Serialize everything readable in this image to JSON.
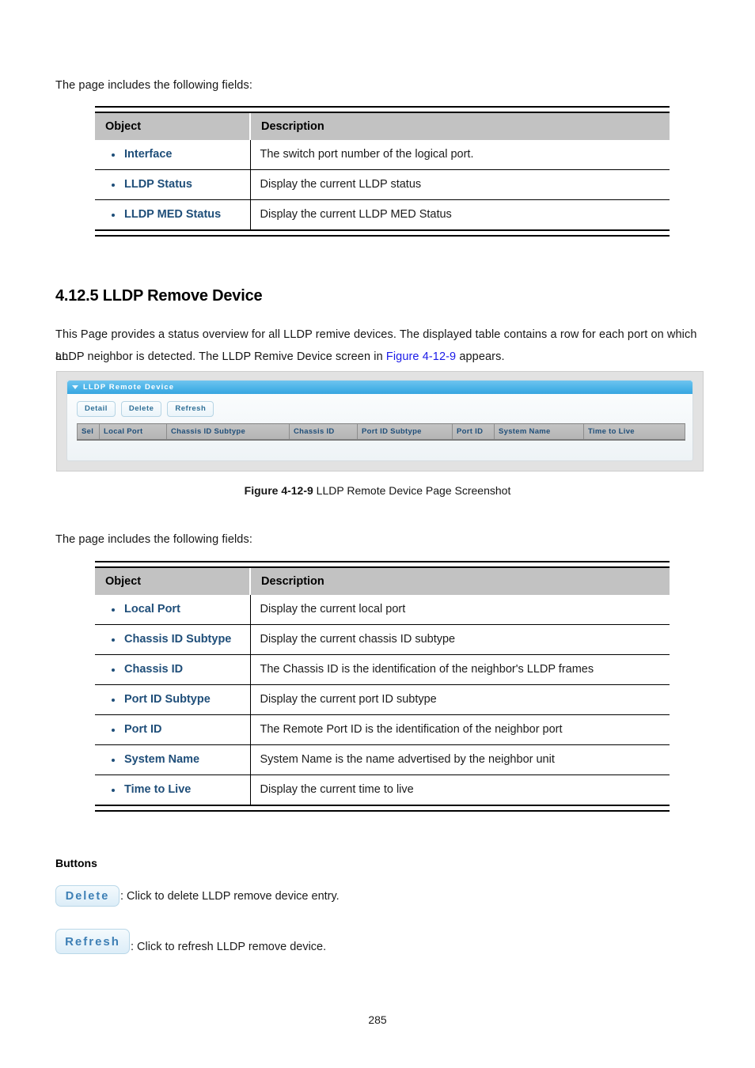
{
  "intro_text_1": "The page includes the following fields:",
  "table_1": {
    "headers": [
      "Object",
      "Description"
    ],
    "rows": [
      {
        "object": "Interface",
        "description": "The switch port number of the logical port."
      },
      {
        "object": "LLDP Status",
        "description": "Display the current LLDP status"
      },
      {
        "object": "LLDP MED Status",
        "description": "Display the current LLDP MED Status"
      }
    ]
  },
  "section": {
    "number": "4.12.5",
    "title": "4.12.5 LLDP Remove Device",
    "body_line_1_a": "This Page provides a status overview for all LLDP remive devices. The displayed table contains a row for each port on which an",
    "body_line_2_a": "LLDP neighbor is detected. The LLDP Remive Device screen in ",
    "body_line_2_link": "Figure 4-12-9",
    "body_line_2_b": " appears."
  },
  "screenshot": {
    "panel_title": "LLDP Remote Device",
    "caret_icon": "chevron-down-icon",
    "buttons": [
      "Detail",
      "Delete",
      "Refresh"
    ],
    "table_headers": [
      "Sel",
      "Local Port",
      "Chassis ID Subtype",
      "Chassis ID",
      "Port ID Subtype",
      "Port ID",
      "System Name",
      "Time to Live"
    ]
  },
  "figure_caption": {
    "label": "Figure 4-12-9",
    "text": " LLDP Remote Device Page Screenshot"
  },
  "intro_text_2": "The page includes the following fields:",
  "table_2": {
    "headers": [
      "Object",
      "Description"
    ],
    "rows": [
      {
        "object": "Local Port",
        "description": "Display the current local port"
      },
      {
        "object": "Chassis ID Subtype",
        "description": "Display the current chassis ID subtype"
      },
      {
        "object": "Chassis ID",
        "description": "The Chassis ID is the identification of the neighbor's LLDP frames"
      },
      {
        "object": "Port ID Subtype",
        "description": "Display the current port ID subtype"
      },
      {
        "object": "Port ID",
        "description": "The Remote Port ID is the identification of the neighbor port"
      },
      {
        "object": "System Name",
        "description": "System Name is the name advertised by the neighbor unit"
      },
      {
        "object": "Time to Live",
        "description": "Display the current time to live"
      }
    ]
  },
  "buttons_section": {
    "heading": "Buttons",
    "items": [
      {
        "button_label": "Delete",
        "description": ": Click to delete LLDP remove device entry."
      },
      {
        "button_label": "Refresh",
        "description": ": Click to refresh LLDP remove device."
      }
    ]
  },
  "page_number": "285",
  "colors": {
    "object_link": "#1f4e79",
    "xref_link": "#1a1ae8",
    "panel_header_blue": "#4cb4e8",
    "table_header_gray": "#bdbdbd"
  }
}
